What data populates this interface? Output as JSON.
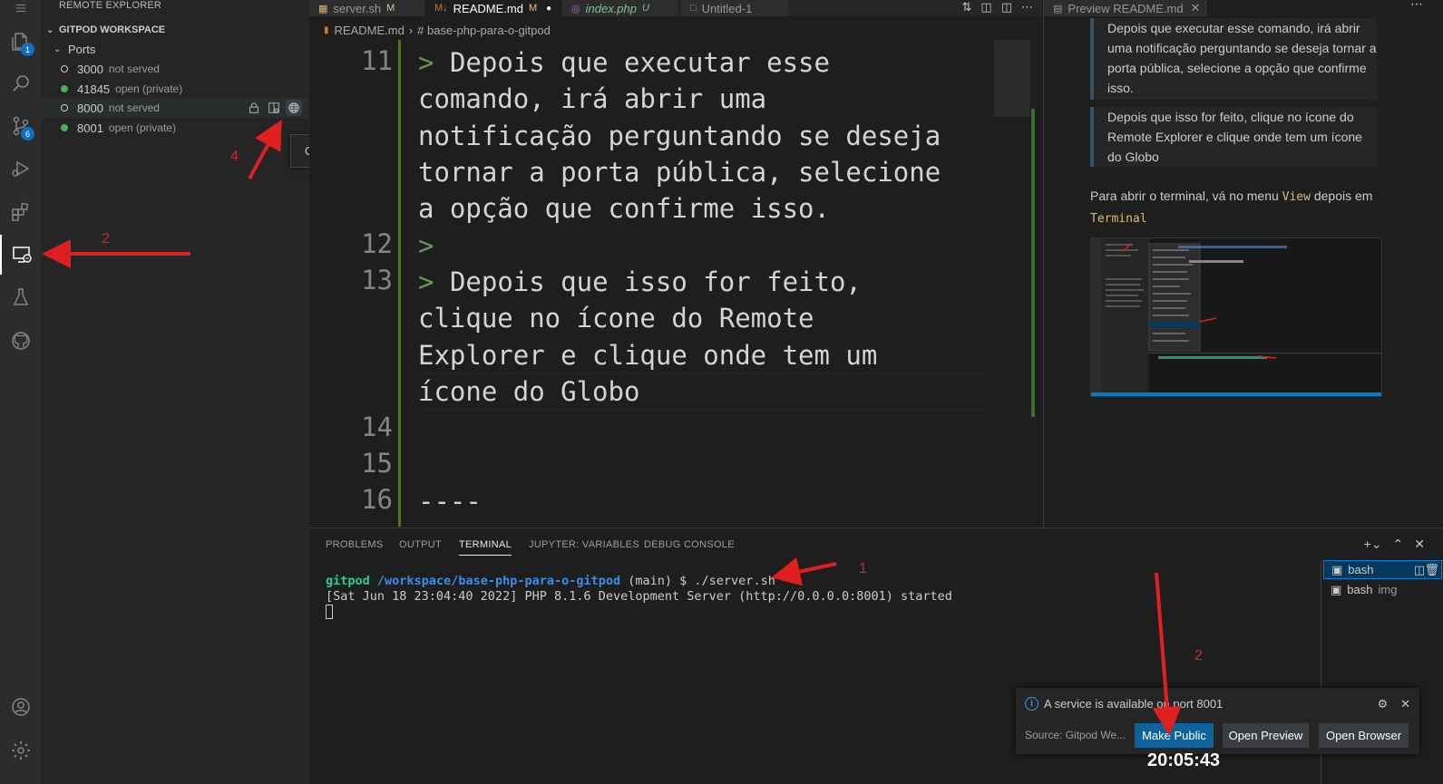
{
  "sidebar": {
    "title": "REMOTE EXPLORER",
    "section": "GITPOD WORKSPACE",
    "group": "Ports",
    "ports": [
      {
        "port": "3000",
        "status": "not served"
      },
      {
        "port": "41845",
        "status": "open (private)"
      },
      {
        "port": "8000",
        "status": "not served"
      },
      {
        "port": "8001",
        "status": "open (private)"
      }
    ],
    "tooltip": "Open Browser"
  },
  "activity": {
    "explorer_badge": "1",
    "scm_badge": "6"
  },
  "tabs": [
    {
      "label": "server.sh",
      "flag": "M"
    },
    {
      "label": "README.md",
      "flag": "M"
    },
    {
      "label": "index.php",
      "flag": "U"
    },
    {
      "label": "Untitled-1",
      "flag": ""
    }
  ],
  "breadcrumb": {
    "file": "README.md",
    "section": "# base-php-para-o-gitpod"
  },
  "editor": {
    "line_numbers": [
      "11",
      "12",
      "13",
      "14",
      "15",
      "16"
    ],
    "line11": [
      "Depois que executar esse",
      "comando, irá abrir uma",
      "notificação perguntando se deseja",
      "tornar a porta pública, selecione",
      "a opção que confirme isso."
    ],
    "line13": [
      "Depois que isso for feito,",
      "clique no ícone do Remote",
      "Explorer e clique onde tem um",
      "ícone do Globo"
    ],
    "line16": "----",
    "quote_mark": ">"
  },
  "preview": {
    "tab": "Preview README.md",
    "quote1": "Depois que executar esse comando, irá abrir uma notificação perguntando se deseja tornar a porta pública, selecione a opção que confirme isso.",
    "quote2": "Depois que isso for feito, clique no ícone do Remote Explorer e clique onde tem um ícone do Globo",
    "para_before": "Para abrir o terminal, vá no menu",
    "menu_word": "View",
    "para_mid": "depois em",
    "terminal_word": "Terminal"
  },
  "panel": {
    "tabs": [
      "PROBLEMS",
      "OUTPUT",
      "TERMINAL",
      "JUPYTER: VARIABLES",
      "DEBUG CONSOLE"
    ],
    "active_tab": "TERMINAL",
    "prompt_user": "gitpod",
    "prompt_path": "/workspace/base-php-para-o-gitpod",
    "prompt_rest": " (main) $ ./server.sh",
    "output": "[Sat Jun 18 23:04:40 2022] PHP 8.1.6 Development Server (http://0.0.0.0:8001) started",
    "terminals": [
      {
        "label": "bash",
        "sub": ""
      },
      {
        "label": "bash",
        "sub": "img"
      }
    ]
  },
  "notification": {
    "message": "A service is available on port 8001",
    "source": "Source: Gitpod We...",
    "buttons": [
      "Make Public",
      "Open Preview",
      "Open Browser"
    ]
  },
  "clock": "20:05:43",
  "annotations": [
    "1",
    "2",
    "2",
    "4"
  ],
  "colors": {
    "accent": "#0e639c",
    "annotation": "#e02020",
    "git_added": "#487e02"
  }
}
